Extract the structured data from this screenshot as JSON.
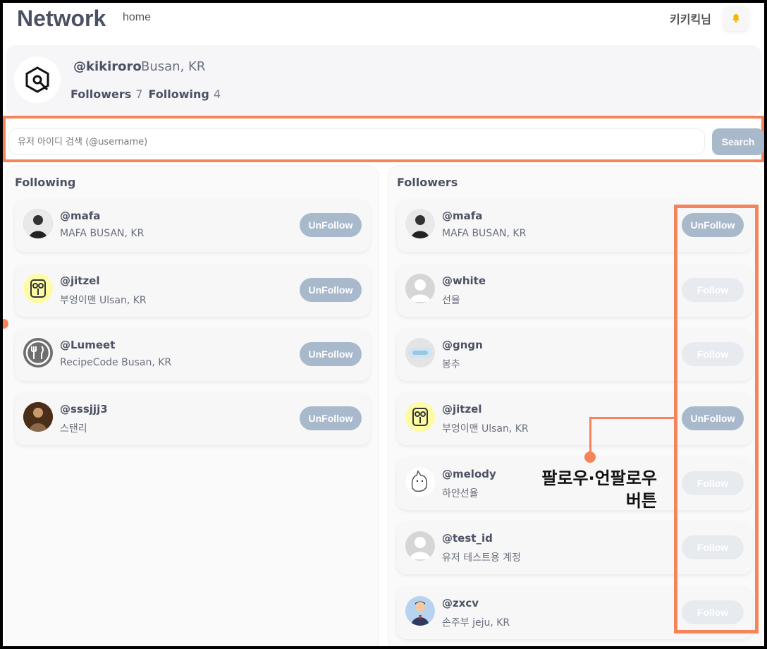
{
  "header": {
    "brand": "Network",
    "nav_home": "home",
    "user": "키키킥님",
    "bell_icon": "bell-icon"
  },
  "profile": {
    "handle": "@kikiroro",
    "location": "Busan, KR",
    "followers_label": "Followers",
    "followers_count": "7",
    "following_label": "Following",
    "following_count": "4"
  },
  "search": {
    "placeholder": "유저 아이디 검색 (@username)",
    "button": "Search"
  },
  "following": {
    "title": "Following",
    "items": [
      {
        "handle": "@mafa",
        "sub": "MAFA BUSAN, KR",
        "action": "UnFollow"
      },
      {
        "handle": "@jitzel",
        "sub": "부엉이맨 Ulsan, KR",
        "action": "UnFollow"
      },
      {
        "handle": "@Lumeet",
        "sub": "RecipeCode Busan, KR",
        "action": "UnFollow"
      },
      {
        "handle": "@sssjjj3",
        "sub": "스탠리",
        "action": "UnFollow"
      }
    ]
  },
  "followers": {
    "title": "Followers",
    "items": [
      {
        "handle": "@mafa",
        "sub": "MAFA BUSAN, KR",
        "action": "UnFollow"
      },
      {
        "handle": "@white",
        "sub": "선율",
        "action": "Follow"
      },
      {
        "handle": "@gngn",
        "sub": "봉추",
        "action": "Follow"
      },
      {
        "handle": "@jitzel",
        "sub": "부엉이맨 Ulsan, KR",
        "action": "UnFollow"
      },
      {
        "handle": "@melody",
        "sub": "하얀선율",
        "action": "Follow"
      },
      {
        "handle": "@test_id",
        "sub": "유저 테스트용 계정",
        "action": "Follow"
      },
      {
        "handle": "@zxcv",
        "sub": "손주부 jeju, KR",
        "action": "Follow"
      }
    ]
  },
  "annotation": {
    "line1": "팔로우·언팔로우",
    "line2": "버튼",
    "color": "#f5845a"
  }
}
